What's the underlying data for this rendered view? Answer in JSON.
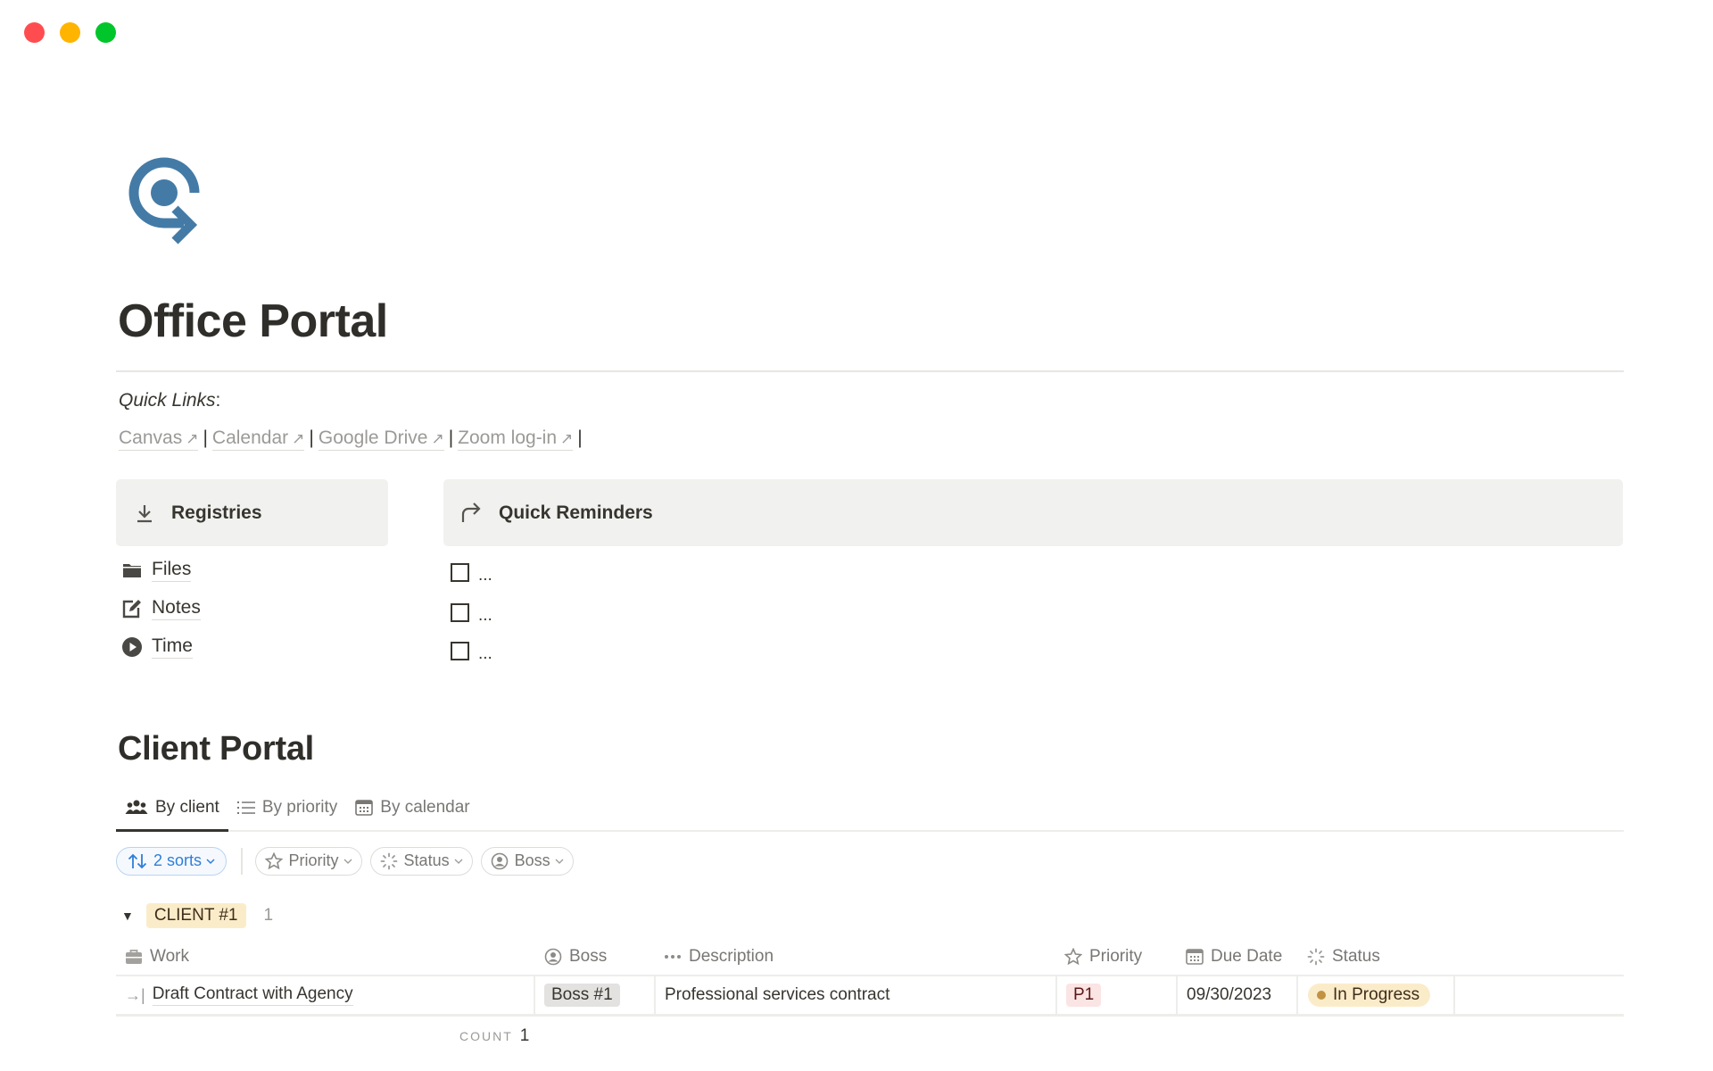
{
  "window": {
    "controls": [
      "close",
      "minimize",
      "zoom"
    ]
  },
  "page": {
    "icon": "target-arrow-icon",
    "icon_color": "#447BA6",
    "title": "Office Portal"
  },
  "quick_links": {
    "label": "Quick Links",
    "label_suffix": ":",
    "separator": "|",
    "arrow": "↗",
    "links": [
      {
        "label": "Canvas"
      },
      {
        "label": "Calendar"
      },
      {
        "label": "Google Drive"
      },
      {
        "label": "Zoom log-in"
      }
    ]
  },
  "registries": {
    "title": "Registries",
    "icon": "download-icon",
    "items": [
      {
        "label": "Files",
        "icon": "folder-icon"
      },
      {
        "label": "Notes",
        "icon": "edit-note-icon"
      },
      {
        "label": "Time",
        "icon": "play-circle-icon"
      }
    ]
  },
  "reminders": {
    "title": "Quick Reminders",
    "icon": "redo-arrow-icon",
    "items": [
      {
        "text": "...",
        "checked": false
      },
      {
        "text": "...",
        "checked": false
      },
      {
        "text": "...",
        "checked": false
      }
    ]
  },
  "client_portal": {
    "title": "Client Portal",
    "tabs": [
      {
        "label": "By client",
        "icon": "people-icon",
        "active": true
      },
      {
        "label": "By priority",
        "icon": "list-icon",
        "active": false
      },
      {
        "label": "By calendar",
        "icon": "calendar-icon",
        "active": false
      }
    ],
    "sorts_label": "2 sorts",
    "filters": [
      {
        "label": "Priority",
        "icon": "star-icon"
      },
      {
        "label": "Status",
        "icon": "status-spinner-icon"
      },
      {
        "label": "Boss",
        "icon": "person-circle-icon"
      }
    ],
    "group": {
      "label": "CLIENT #1",
      "count": "1"
    },
    "columns": [
      {
        "label": "Work",
        "icon": "briefcase-icon"
      },
      {
        "label": "Boss",
        "icon": "person-circle-icon"
      },
      {
        "label": "Description",
        "icon": "dots-icon"
      },
      {
        "label": "Priority",
        "icon": "star-icon"
      },
      {
        "label": "Due Date",
        "icon": "calendar-icon"
      },
      {
        "label": "Status",
        "icon": "status-spinner-icon"
      }
    ],
    "rows": [
      {
        "work": "Draft Contract with Agency",
        "boss": "Boss #1",
        "description": "Professional services contract",
        "priority": "P1",
        "due_date": "09/30/2023",
        "status": "In Progress"
      }
    ],
    "footer": {
      "count_label": "COUNT",
      "count_value": "1"
    }
  },
  "colors": {
    "accent_blue": "#2F7ED8",
    "status_in_progress_bg": "#FBECC9",
    "status_in_progress_dot": "#C29243",
    "priority_p1_bg": "#FBE4E4",
    "callout_bg": "#F1F1EF"
  }
}
